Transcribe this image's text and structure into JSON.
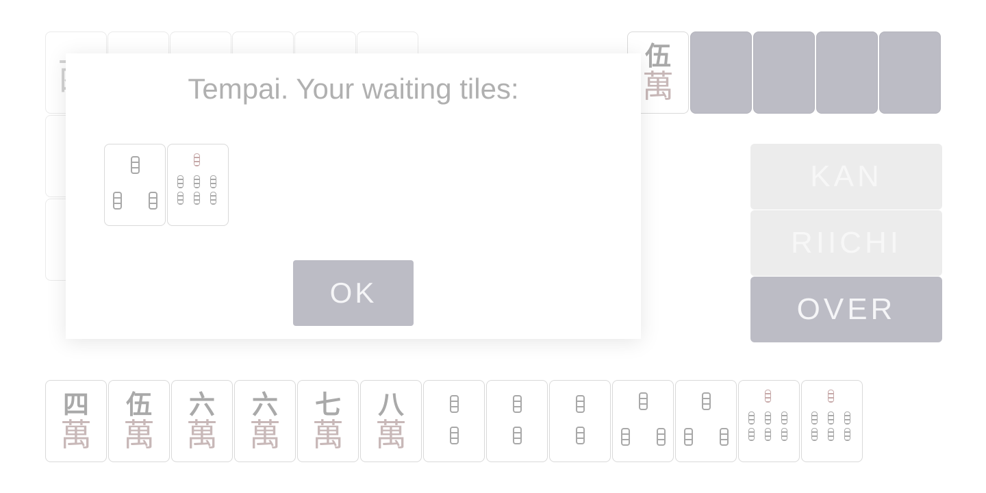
{
  "dialog": {
    "title": "Tempai. Your waiting tiles:",
    "waiting_tiles": [
      {
        "suit": "sou",
        "rank": 3,
        "icon": "3-sou-tile-icon"
      },
      {
        "suit": "sou",
        "rank": 9,
        "icon": "9-sou-tile-icon"
      }
    ],
    "ok_label": "OK"
  },
  "actions": {
    "kan_label": "KAN",
    "riichi_label": "RIICHI",
    "over_label": "OVER"
  },
  "dora_row": {
    "revealed": {
      "num": "伍",
      "kanji": "萬",
      "suit": "man",
      "rank": 5
    },
    "hidden_count": 4
  },
  "hand": [
    {
      "suit": "man",
      "rank": 4,
      "num": "四",
      "kanji": "萬"
    },
    {
      "suit": "man",
      "rank": 5,
      "num": "伍",
      "kanji": "萬"
    },
    {
      "suit": "man",
      "rank": 6,
      "num": "六",
      "kanji": "萬"
    },
    {
      "suit": "man",
      "rank": 6,
      "num": "六",
      "kanji": "萬"
    },
    {
      "suit": "man",
      "rank": 7,
      "num": "七",
      "kanji": "萬"
    },
    {
      "suit": "man",
      "rank": 8,
      "num": "八",
      "kanji": "萬"
    },
    {
      "suit": "sou",
      "rank": 2
    },
    {
      "suit": "sou",
      "rank": 2
    },
    {
      "suit": "sou",
      "rank": 2
    },
    {
      "suit": "sou",
      "rank": 3
    },
    {
      "suit": "sou",
      "rank": 3
    },
    {
      "suit": "sou",
      "rank": 9
    },
    {
      "suit": "sou",
      "rank": 9
    }
  ],
  "colors": {
    "button_enabled": "#bcbcc5",
    "button_disabled": "#ececec",
    "tile_back": "#bcbcc5",
    "text_muted": "#b0b0b0"
  }
}
